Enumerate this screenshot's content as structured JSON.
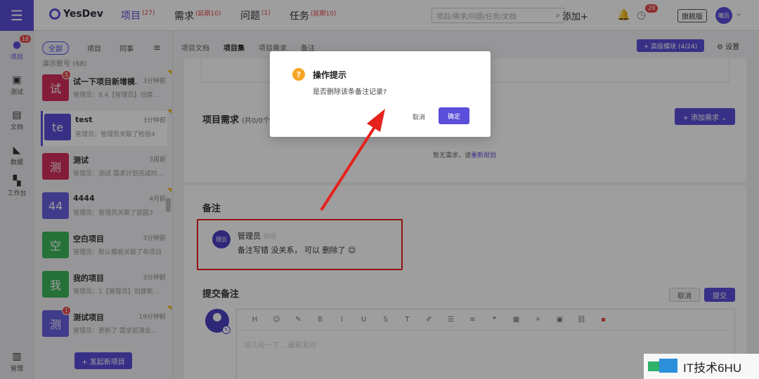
{
  "rail": {
    "items": [
      {
        "label": "项目",
        "badge": "16",
        "icon": "yesdev-logo-icon"
      },
      {
        "label": "测试",
        "icon": "test-icon"
      },
      {
        "label": "文档",
        "icon": "document-icon"
      },
      {
        "label": "数据",
        "icon": "chart-icon"
      },
      {
        "label": "工作台",
        "icon": "grid-icon"
      },
      {
        "label": "管理",
        "icon": "manage-icon"
      }
    ]
  },
  "topbar": {
    "brand": "YesDev",
    "nav": [
      {
        "label": "项目",
        "sup": "(27)"
      },
      {
        "label": "需求",
        "sup": "(延期10)"
      },
      {
        "label": "问题",
        "sup": "(1)"
      },
      {
        "label": "任务",
        "sup": "(延期10)"
      }
    ],
    "search_placeholder": "项目/需求/问题/任务/文档",
    "add_label": "添加+",
    "clock_badge": "29",
    "edition": "旗舰版",
    "avatar": "曦员"
  },
  "panel": {
    "filters": [
      "全部",
      "项目",
      "同事"
    ],
    "account": "演示账号 (68)",
    "projects": [
      {
        "avatar": "试",
        "color": "#d6305c",
        "badge": "5",
        "name": "试一下项目新增模...",
        "time": "3分钟前",
        "desc": "管理员：8.4【管理员】创建...",
        "flag": true
      },
      {
        "avatar": "te",
        "color": "#5b4ed8",
        "name": "test",
        "time": "3分钟前",
        "desc": "管理员：管理员关联了检验4",
        "flag": true,
        "selected": true
      },
      {
        "avatar": "测",
        "color": "#d6305c",
        "name": "测试",
        "time": "3周前",
        "desc": "管理员：测试 需求计划完成时...",
        "flag": false
      },
      {
        "avatar": "44",
        "color": "#6a5fe0",
        "name": "4444",
        "time": "4月前",
        "desc": "管理员：管理员关联了部圆3",
        "flag": true
      },
      {
        "avatar": "空",
        "color": "#3db75b",
        "name": "空白项目",
        "time": "3分钟前",
        "desc": "管理员：默认模板关联了布项目",
        "flag": false
      },
      {
        "avatar": "我",
        "color": "#3db75b",
        "name": "我的项目",
        "time": "3分钟前",
        "desc": "管理员：1【管理员】创建新...",
        "flag": false
      },
      {
        "avatar": "测",
        "color": "#6a5fe0",
        "badge": "1",
        "name": "测试项目",
        "time": "19分钟前",
        "desc": "管理员：更新了 需求前满会...",
        "flag": true
      }
    ],
    "new_project": "+ 发起新项目"
  },
  "tabs": {
    "items": [
      "项目文档",
      "项目集",
      "项目需求",
      "备注"
    ],
    "active": 1,
    "right_button": "+ 高级模块 (4/24)",
    "settings": "设置"
  },
  "requirements": {
    "title": "项目需求",
    "count": "(共0/0个)",
    "add_button": "+ 添加需求 ⌄",
    "empty_text": "暂无需求，请",
    "empty_link": "重新规划"
  },
  "notes": {
    "title": "备注",
    "avatar": "理员",
    "author": "管理员",
    "time": "刚刚",
    "text": "备注写错 没关系， 可以 删除了 😊"
  },
  "submit": {
    "title": "提交备注",
    "cancel": "取消",
    "submit": "提交",
    "placeholder": "说几句一下... 最新发问",
    "toolbar": [
      "H",
      "☺",
      "✎",
      "B",
      "I",
      "U",
      "S",
      "T",
      "✐",
      "☰",
      "≡",
      "❝",
      "▦",
      "⌗",
      "▣",
      "⛓",
      "▪"
    ]
  },
  "modal": {
    "icon": "?",
    "title": "操作提示",
    "message": "是否删除该条备注记录?",
    "cancel": "取消",
    "confirm": "确定"
  },
  "watermark": {
    "text": "IT技术6HU"
  },
  "colors": {
    "accent": "#5b4ed8",
    "danger": "#e5221d",
    "warning": "#f5a623"
  }
}
